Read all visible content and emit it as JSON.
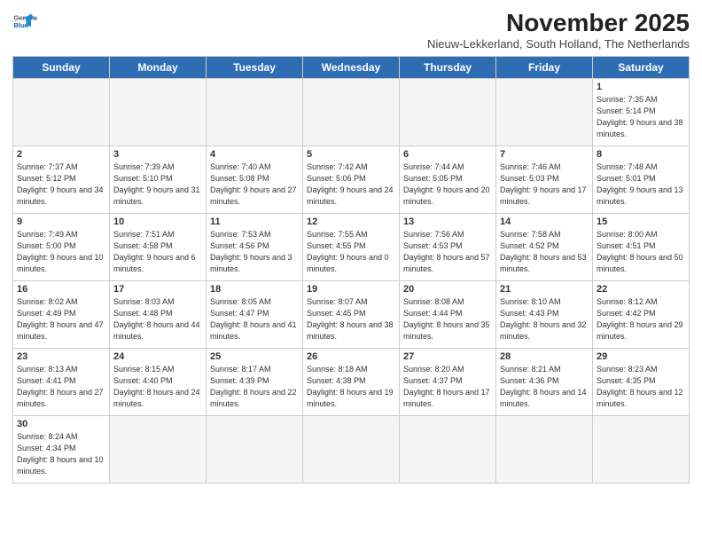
{
  "header": {
    "logo_general": "General",
    "logo_blue": "Blue",
    "main_title": "November 2025",
    "subtitle": "Nieuw-Lekkerland, South Holland, The Netherlands"
  },
  "days_of_week": [
    "Sunday",
    "Monday",
    "Tuesday",
    "Wednesday",
    "Thursday",
    "Friday",
    "Saturday"
  ],
  "weeks": [
    [
      {
        "day": "",
        "info": ""
      },
      {
        "day": "",
        "info": ""
      },
      {
        "day": "",
        "info": ""
      },
      {
        "day": "",
        "info": ""
      },
      {
        "day": "",
        "info": ""
      },
      {
        "day": "",
        "info": ""
      },
      {
        "day": "1",
        "info": "Sunrise: 7:35 AM\nSunset: 5:14 PM\nDaylight: 9 hours\nand 38 minutes."
      }
    ],
    [
      {
        "day": "2",
        "info": "Sunrise: 7:37 AM\nSunset: 5:12 PM\nDaylight: 9 hours\nand 34 minutes."
      },
      {
        "day": "3",
        "info": "Sunrise: 7:39 AM\nSunset: 5:10 PM\nDaylight: 9 hours\nand 31 minutes."
      },
      {
        "day": "4",
        "info": "Sunrise: 7:40 AM\nSunset: 5:08 PM\nDaylight: 9 hours\nand 27 minutes."
      },
      {
        "day": "5",
        "info": "Sunrise: 7:42 AM\nSunset: 5:06 PM\nDaylight: 9 hours\nand 24 minutes."
      },
      {
        "day": "6",
        "info": "Sunrise: 7:44 AM\nSunset: 5:05 PM\nDaylight: 9 hours\nand 20 minutes."
      },
      {
        "day": "7",
        "info": "Sunrise: 7:46 AM\nSunset: 5:03 PM\nDaylight: 9 hours\nand 17 minutes."
      },
      {
        "day": "8",
        "info": "Sunrise: 7:48 AM\nSunset: 5:01 PM\nDaylight: 9 hours\nand 13 minutes."
      }
    ],
    [
      {
        "day": "9",
        "info": "Sunrise: 7:49 AM\nSunset: 5:00 PM\nDaylight: 9 hours\nand 10 minutes."
      },
      {
        "day": "10",
        "info": "Sunrise: 7:51 AM\nSunset: 4:58 PM\nDaylight: 9 hours\nand 6 minutes."
      },
      {
        "day": "11",
        "info": "Sunrise: 7:53 AM\nSunset: 4:56 PM\nDaylight: 9 hours\nand 3 minutes."
      },
      {
        "day": "12",
        "info": "Sunrise: 7:55 AM\nSunset: 4:55 PM\nDaylight: 9 hours\nand 0 minutes."
      },
      {
        "day": "13",
        "info": "Sunrise: 7:56 AM\nSunset: 4:53 PM\nDaylight: 8 hours\nand 57 minutes."
      },
      {
        "day": "14",
        "info": "Sunrise: 7:58 AM\nSunset: 4:52 PM\nDaylight: 8 hours\nand 53 minutes."
      },
      {
        "day": "15",
        "info": "Sunrise: 8:00 AM\nSunset: 4:51 PM\nDaylight: 8 hours\nand 50 minutes."
      }
    ],
    [
      {
        "day": "16",
        "info": "Sunrise: 8:02 AM\nSunset: 4:49 PM\nDaylight: 8 hours\nand 47 minutes."
      },
      {
        "day": "17",
        "info": "Sunrise: 8:03 AM\nSunset: 4:48 PM\nDaylight: 8 hours\nand 44 minutes."
      },
      {
        "day": "18",
        "info": "Sunrise: 8:05 AM\nSunset: 4:47 PM\nDaylight: 8 hours\nand 41 minutes."
      },
      {
        "day": "19",
        "info": "Sunrise: 8:07 AM\nSunset: 4:45 PM\nDaylight: 8 hours\nand 38 minutes."
      },
      {
        "day": "20",
        "info": "Sunrise: 8:08 AM\nSunset: 4:44 PM\nDaylight: 8 hours\nand 35 minutes."
      },
      {
        "day": "21",
        "info": "Sunrise: 8:10 AM\nSunset: 4:43 PM\nDaylight: 8 hours\nand 32 minutes."
      },
      {
        "day": "22",
        "info": "Sunrise: 8:12 AM\nSunset: 4:42 PM\nDaylight: 8 hours\nand 29 minutes."
      }
    ],
    [
      {
        "day": "23",
        "info": "Sunrise: 8:13 AM\nSunset: 4:41 PM\nDaylight: 8 hours\nand 27 minutes."
      },
      {
        "day": "24",
        "info": "Sunrise: 8:15 AM\nSunset: 4:40 PM\nDaylight: 8 hours\nand 24 minutes."
      },
      {
        "day": "25",
        "info": "Sunrise: 8:17 AM\nSunset: 4:39 PM\nDaylight: 8 hours\nand 22 minutes."
      },
      {
        "day": "26",
        "info": "Sunrise: 8:18 AM\nSunset: 4:38 PM\nDaylight: 8 hours\nand 19 minutes."
      },
      {
        "day": "27",
        "info": "Sunrise: 8:20 AM\nSunset: 4:37 PM\nDaylight: 8 hours\nand 17 minutes."
      },
      {
        "day": "28",
        "info": "Sunrise: 8:21 AM\nSunset: 4:36 PM\nDaylight: 8 hours\nand 14 minutes."
      },
      {
        "day": "29",
        "info": "Sunrise: 8:23 AM\nSunset: 4:35 PM\nDaylight: 8 hours\nand 12 minutes."
      }
    ],
    [
      {
        "day": "30",
        "info": "Sunrise: 8:24 AM\nSunset: 4:34 PM\nDaylight: 8 hours\nand 10 minutes."
      },
      {
        "day": "",
        "info": ""
      },
      {
        "day": "",
        "info": ""
      },
      {
        "day": "",
        "info": ""
      },
      {
        "day": "",
        "info": ""
      },
      {
        "day": "",
        "info": ""
      },
      {
        "day": "",
        "info": ""
      }
    ]
  ]
}
